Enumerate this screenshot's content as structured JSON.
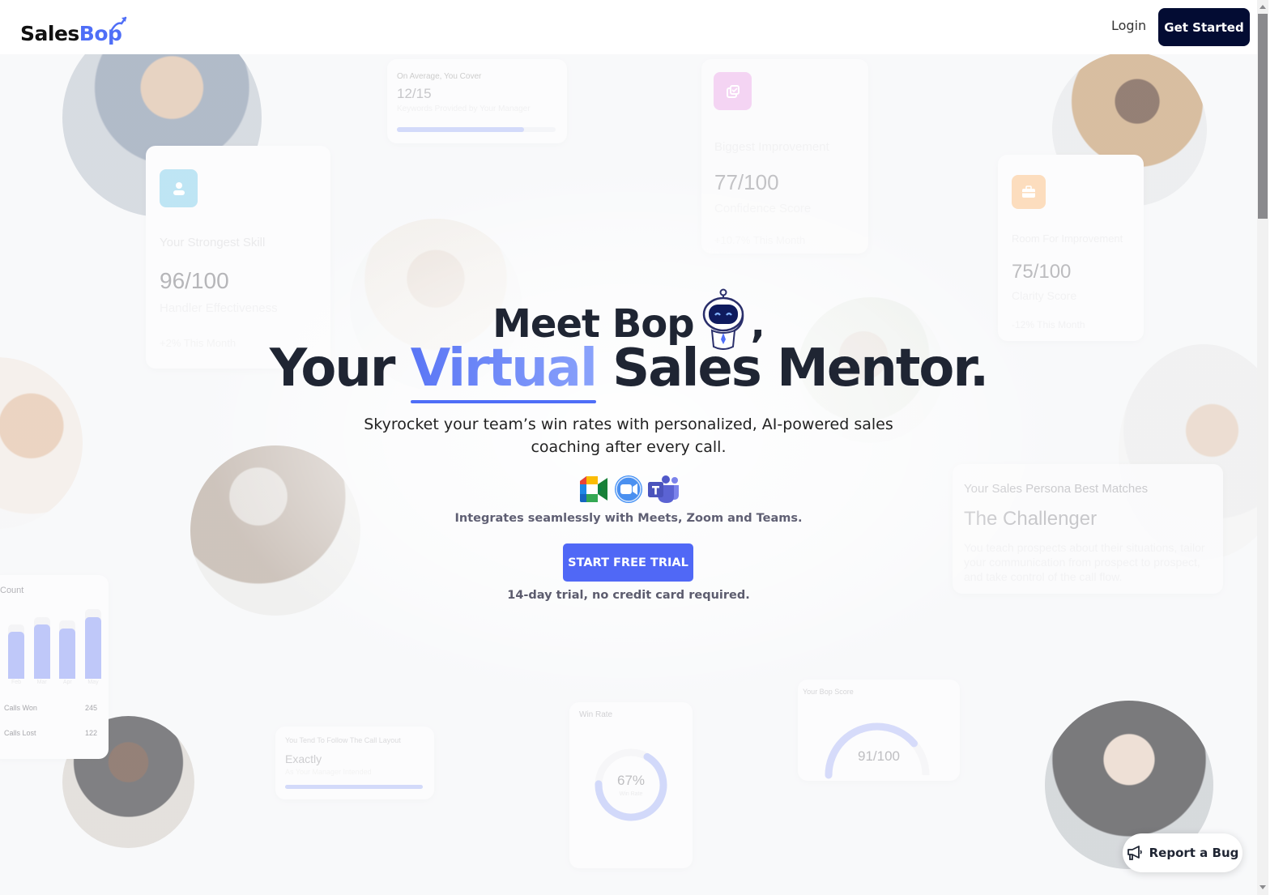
{
  "header": {
    "logo_part1": "Sales",
    "logo_part2": "Bop",
    "login_label": "Login",
    "get_started_label": "Get Started"
  },
  "hero": {
    "line1_text": "Meet Bop",
    "line1_suffix": ",",
    "line2_prefix": "Your ",
    "line2_highlight": "Virtual",
    "line2_suffix": " Sales Mentor.",
    "subtitle": "Skyrocket your team’s win rates with personalized, AI-powered sales coaching after every call.",
    "integrations": [
      {
        "name": "Google Meet",
        "icon": "google-meet-icon"
      },
      {
        "name": "Zoom",
        "icon": "zoom-icon"
      },
      {
        "name": "Microsoft Teams",
        "icon": "teams-icon"
      }
    ],
    "integrations_text": "Integrates seamlessly with Meets, Zoom and Teams.",
    "cta_label": "START FREE TRIAL",
    "trial_note": "14-day trial, no credit card required."
  },
  "background_cards": {
    "coverage": {
      "title": "On Average, You Cover",
      "value": "12/15",
      "subtitle": "Keywords Provided by Your Manager",
      "progress": 0.8
    },
    "strongest_skill": {
      "title": "Your Strongest Skill",
      "value": "96/100",
      "metric": "Handler Effectiveness",
      "change": "+2% This Month",
      "icon": "user-icon"
    },
    "biggest_improvement": {
      "title": "Biggest Improvement",
      "value": "77/100",
      "metric": "Confidence Score",
      "change": "+10.7% This Month",
      "icon": "checklist-icon"
    },
    "room_for_improvement": {
      "title": "Room For Improvement",
      "value": "75/100",
      "metric": "Clarity Score",
      "change": "-12% This Month",
      "icon": "briefcase-icon"
    },
    "persona": {
      "title": "Your Sales Persona Best Matches",
      "value": "The Challenger",
      "description": "You teach prospects about their situations, tailor your communication from prospect to prospect, and take control of the call flow."
    },
    "call_count": {
      "title": "Count",
      "months": [
        "Feb",
        "Mar",
        "Apr",
        "May"
      ],
      "values": [
        0.62,
        0.72,
        0.67,
        0.82
      ],
      "rows": [
        {
          "label": "Calls Won",
          "value": "245"
        },
        {
          "label": "Calls Lost",
          "value": "122"
        }
      ]
    },
    "call_layout": {
      "title": "You Tend To Follow The Call Layout",
      "value": "Exactly",
      "subtitle": "As Your Manager Intended",
      "progress": 1.0
    },
    "win_rate": {
      "title": "Win Rate",
      "value": "67%",
      "subtitle": "Win Rate",
      "fraction": 0.67
    },
    "bop_score": {
      "title": "Your Bop Score",
      "value": "91/100",
      "fraction": 0.91
    }
  },
  "report_bug": {
    "label": "Report a Bug",
    "icon": "megaphone-icon"
  },
  "colors": {
    "brand_blue": "#4f6ef7",
    "dark_navy": "#030c33",
    "cta_blue": "#5068f6",
    "heading": "#1f2533"
  }
}
